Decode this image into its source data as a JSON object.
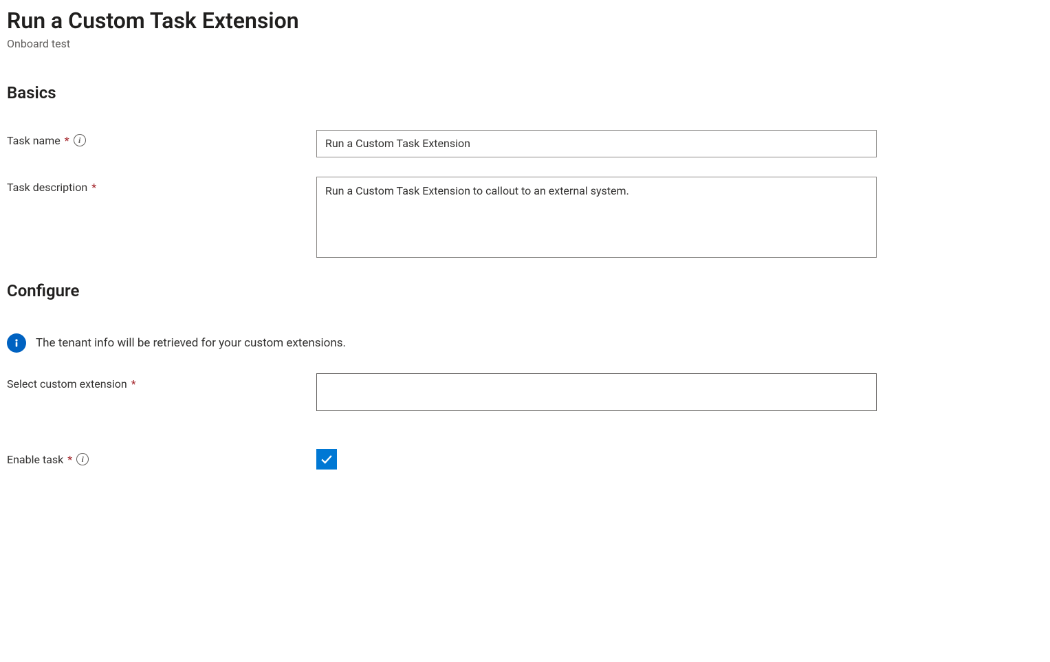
{
  "page": {
    "title": "Run a Custom Task Extension",
    "subtitle": "Onboard test"
  },
  "sections": {
    "basics": "Basics",
    "configure": "Configure"
  },
  "basics": {
    "task_name": {
      "label": "Task name",
      "value": "Run a Custom Task Extension"
    },
    "task_description": {
      "label": "Task description",
      "value": "Run a Custom Task Extension to callout to an external system."
    }
  },
  "configure": {
    "notice": "The tenant info will be retrieved for your custom extensions.",
    "select_extension": {
      "label": "Select custom extension",
      "value": ""
    },
    "enable_task": {
      "label": "Enable task",
      "checked": true
    }
  }
}
